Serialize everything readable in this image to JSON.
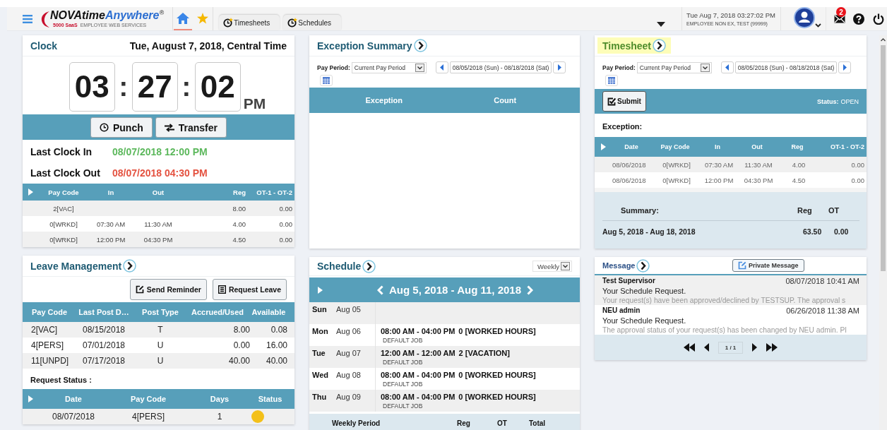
{
  "header": {
    "logo": {
      "dark": "NOVAtime",
      "blue": "Anywhere",
      "mark": "®",
      "brand": "5000 SaaS",
      "tagline": "EMPLOYEE WEB SERVICES"
    },
    "nav": [
      {
        "kind": "home",
        "selected": true
      },
      {
        "kind": "favorites",
        "selected": false
      }
    ],
    "tabs": [
      {
        "label": "Timesheets"
      },
      {
        "label": "Schedules"
      }
    ],
    "datetime": "Tue Aug 7, 2018 03:27:02 PM",
    "user": "EMPLOYEE NON EX, TEST (99999)",
    "mail_count": "2"
  },
  "clock": {
    "title": "Clock",
    "date": "Tue, August 7, 2018, Central Time",
    "digits": [
      "03",
      "27",
      "02"
    ],
    "separators": [
      ":",
      ":"
    ],
    "meridiem": "PM",
    "buttons": [
      {
        "kind": "punch",
        "label": "Punch"
      },
      {
        "kind": "transfer",
        "label": "Transfer"
      }
    ],
    "last": [
      {
        "kind": "in",
        "label": "Last Clock In",
        "value": "08/07/2018 12:00 PM"
      },
      {
        "kind": "out",
        "label": "Last Clock Out",
        "value": "08/07/2018 04:30 PM"
      }
    ],
    "columns": [
      "Pay Code",
      "In",
      "Out",
      "Reg",
      "OT-1 - OT-2"
    ],
    "rows": [
      {
        "pay_code": "2[VAC]",
        "reg": "8.00",
        "ot": "0.00"
      },
      {
        "pay_code": "0[WRKD]",
        "in": "07:30 AM",
        "out": "11:30 AM",
        "reg": "4.00",
        "ot": "0.00"
      },
      {
        "pay_code": "0[WRKD]",
        "in": "12:00 PM",
        "out": "04:30 PM",
        "reg": "4.50",
        "ot": "0.00"
      }
    ]
  },
  "exception_summary": {
    "title": "Exception Summary",
    "pay_period": {
      "label": "Pay Period:",
      "value": "Current Pay Period",
      "range": "08/05/2018 (Sun) - 08/18/2018 (Sat)"
    },
    "columns": [
      "Exception",
      "Count"
    ]
  },
  "timesheet": {
    "title": "Timesheet",
    "highlighted": true,
    "pay_period": {
      "label": "Pay Period:",
      "value": "Current Pay Period",
      "range": "08/05/2018 (Sun) - 08/18/2018 (Sat)"
    },
    "submit": "Submit",
    "status_label": "Status:",
    "status": "OPEN",
    "exception_label": "Exception:",
    "columns": [
      "Date",
      "Pay Code",
      "In",
      "Out",
      "Reg",
      "OT-1 - OT-2"
    ],
    "rows": [
      {
        "date": "08/06/2018",
        "pay_code": "0[WRKD]",
        "in": "07:30 AM",
        "out": "11:30 AM",
        "reg": "4.00",
        "ot": "0.00"
      },
      {
        "date": "08/06/2018",
        "pay_code": "0[WRKD]",
        "in": "12:00 PM",
        "out": "04:30 PM",
        "reg": "4.50",
        "ot": "0.00"
      }
    ],
    "summary": {
      "label": "Summary:",
      "columns": [
        "Reg",
        "OT"
      ],
      "period": "Aug 5, 2018 - Aug 18, 2018",
      "values": [
        "63.50",
        "0.00"
      ]
    }
  },
  "leave": {
    "title": "Leave Management",
    "buttons": [
      {
        "kind": "reminder",
        "label": "Send Reminder"
      },
      {
        "kind": "request",
        "label": "Request Leave"
      }
    ],
    "columns": [
      "Pay Code",
      "Last Post D…",
      "Post Type",
      "Accrued/Used",
      "Available"
    ],
    "rows": [
      [
        "2[VAC]",
        "08/15/2018",
        "T",
        "8.00",
        "0.08"
      ],
      [
        "4[PERS]",
        "07/01/2018",
        "U",
        "0.00",
        "16.00"
      ],
      [
        "11[UNPD]",
        "07/17/2018",
        "U",
        "40.00",
        "40.00"
      ]
    ],
    "request_label": "Request Status :",
    "request_columns": [
      "Date",
      "Pay Code",
      "Days",
      "Status"
    ],
    "requests": [
      {
        "date": "08/07/2018",
        "pay_code": "4[PERS]",
        "days": "1"
      }
    ]
  },
  "schedule": {
    "title": "Schedule",
    "view": "Weekly",
    "range": "Aug 5, 2018 - Aug 11, 2018",
    "days": [
      {
        "day": "Sun",
        "date": "Aug 05"
      },
      {
        "day": "Mon",
        "date": "Aug 06",
        "time": "08:00 AM - 04:00 PM",
        "code": "0 [WORKED HOURS]",
        "job": "DEFAULT JOB"
      },
      {
        "day": "Tue",
        "date": "Aug 07",
        "time": "12:00 AM - 12:00 AM",
        "code": "2 [VACATION]",
        "job": "DEFAULT JOB"
      },
      {
        "day": "Wed",
        "date": "Aug 08",
        "time": "08:00 AM - 04:00 PM",
        "code": "0 [WORKED HOURS]",
        "job": "DEFAULT JOB"
      },
      {
        "day": "Thu",
        "date": "Aug 09",
        "time": "08:00 AM - 04:00 PM",
        "code": "0 [WORKED HOURS]",
        "job": "DEFAULT JOB"
      }
    ],
    "footer_columns": [
      "Weekly Period",
      "Reg",
      "OT",
      "Total"
    ]
  },
  "message": {
    "title": "Message",
    "button": "Private Message",
    "items": [
      {
        "sender": "Test Supervisor",
        "date": "08/07/2018 10:41 AM",
        "subject": "Your Schedule Request.",
        "preview": "Your request(s) have been approved/declined by TESTSUP. The approval s"
      },
      {
        "sender": "NEU admin",
        "date": "06/26/2018 11:38 AM",
        "subject": "Your Schedule Request.",
        "preview": "The approval status of your request(s) has been changed by NEU admin. Pl"
      }
    ],
    "page": "1 / 1"
  }
}
